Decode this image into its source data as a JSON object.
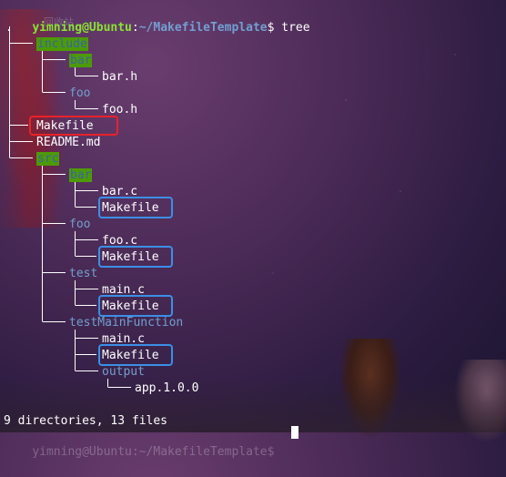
{
  "terminal": {
    "prompt": {
      "user_host": "yimning@Ubuntu",
      "path": "~/MakefileTemplate",
      "symbol": "$",
      "command": "tree"
    },
    "tree_root": ".",
    "entries": [
      {
        "name": "include",
        "kind": "dir",
        "highlight": true
      },
      {
        "name": "bar",
        "kind": "dir",
        "highlight": true
      },
      {
        "name": "bar.h",
        "kind": "file"
      },
      {
        "name": "foo",
        "kind": "dir"
      },
      {
        "name": "foo.h",
        "kind": "file"
      },
      {
        "name": "Makefile",
        "kind": "file",
        "box": "red"
      },
      {
        "name": "README.md",
        "kind": "file"
      },
      {
        "name": "src",
        "kind": "dir",
        "highlight": true
      },
      {
        "name": "bar",
        "kind": "dir",
        "highlight": true
      },
      {
        "name": "bar.c",
        "kind": "file"
      },
      {
        "name": "Makefile",
        "kind": "file",
        "box": "blue"
      },
      {
        "name": "foo",
        "kind": "dir"
      },
      {
        "name": "foo.c",
        "kind": "file"
      },
      {
        "name": "Makefile",
        "kind": "file",
        "box": "blue"
      },
      {
        "name": "test",
        "kind": "dir"
      },
      {
        "name": "main.c",
        "kind": "file"
      },
      {
        "name": "Makefile",
        "kind": "file",
        "box": "blue"
      },
      {
        "name": "testMainFunction",
        "kind": "dir"
      },
      {
        "name": "main.c",
        "kind": "file"
      },
      {
        "name": "Makefile",
        "kind": "file",
        "box": "blue"
      },
      {
        "name": "output",
        "kind": "dir"
      },
      {
        "name": "app.1.0.0",
        "kind": "file"
      }
    ],
    "summary": "9 directories, 13 files",
    "watermark": "回收站"
  },
  "colors": {
    "user_host": "#8ae234",
    "path": "#729fcf",
    "dir": "#729fcf",
    "dir_highlight_bg": "#4e9a06",
    "highlight_box_red": "#e8222a",
    "highlight_box_blue": "#3b8fe6"
  }
}
